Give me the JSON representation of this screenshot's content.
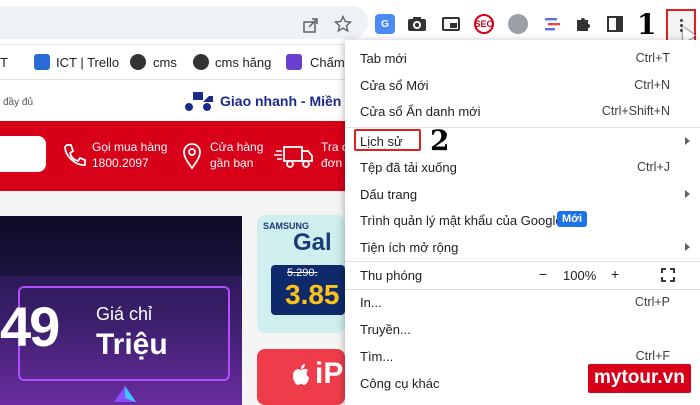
{
  "colors": {
    "accent_red": "#d70018",
    "highlight_red": "#e02020",
    "badge_blue": "#1a73e8"
  },
  "toolbar": {
    "share_icon": "share-icon",
    "bookmark_icon": "star-icon",
    "extensions": [
      "google-translate-icon",
      "camera-icon",
      "pip-icon",
      "seo-icon",
      "screenshot-icon",
      "list-icon",
      "puzzle-icon",
      "sidepanel-icon"
    ],
    "seo_label": "SEO",
    "menu_icon": "kebab-menu-icon"
  },
  "annotations": {
    "step1": "1",
    "step2": "2"
  },
  "bookmarks": [
    {
      "label": "T",
      "icon": "bookmark-page-icon"
    },
    {
      "label": "ICT | Trello",
      "icon": "trello-icon"
    },
    {
      "label": "cms",
      "icon": "globe-icon"
    },
    {
      "label": "cms hăng",
      "icon": "globe-icon"
    },
    {
      "label": "Chấm",
      "icon": "form-icon"
    }
  ],
  "page": {
    "topstrip_left": "đầy đủ",
    "delivery": "Giao nhanh - Miền",
    "hotline_title": "Gọi mua hàng",
    "hotline_number": "1800.2097",
    "store_title": "Cửa hàng",
    "store_sub": "gần bạn",
    "track_title": "Tra c",
    "track_sub": "đơn",
    "promo_price": "49",
    "promo_gia": "Giá chỉ",
    "promo_unit": "Triệu",
    "samsung_label": "SAMSUNG",
    "galaxy_text": "Gal",
    "old_price": "5.290.",
    "new_price": "3.85",
    "iphone_text": "iP"
  },
  "menu": {
    "items": [
      {
        "label": "Tab mới",
        "shortcut": "Ctrl+T"
      },
      {
        "label": "Cửa sổ Mới",
        "shortcut": "Ctrl+N"
      },
      {
        "label": "Cửa sổ Ẩn danh mới",
        "shortcut": "Ctrl+Shift+N"
      },
      {
        "label": "Lịch sử",
        "shortcut": ""
      },
      {
        "label": "Tệp đã tải xuống",
        "shortcut": "Ctrl+J"
      },
      {
        "label": "Dấu trang",
        "shortcut": ""
      },
      {
        "label": "Trình quản lý mật khẩu của Google",
        "shortcut": "",
        "badge": "Mới"
      },
      {
        "label": "Tiện ích mở rộng",
        "shortcut": ""
      },
      {
        "label": "Thu phóng",
        "zoom_minus": "−",
        "zoom_value": "100%",
        "zoom_plus": "+"
      },
      {
        "label": "In...",
        "shortcut": "Ctrl+P"
      },
      {
        "label": "Truyền...",
        "shortcut": ""
      },
      {
        "label": "Tìm...",
        "shortcut": "Ctrl+F"
      },
      {
        "label": "Công cụ khác",
        "shortcut": ""
      }
    ]
  },
  "watermark": "mytour.vn"
}
